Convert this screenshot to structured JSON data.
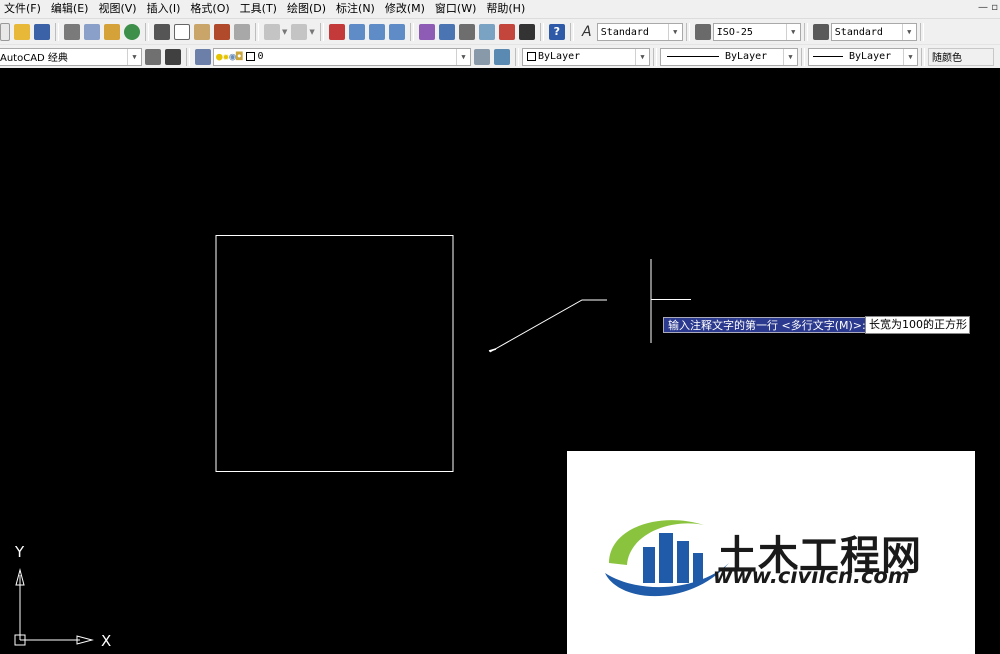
{
  "menu": [
    "文件(F)",
    "编辑(E)",
    "视图(V)",
    "插入(I)",
    "格式(O)",
    "工具(T)",
    "绘图(D)",
    "标注(N)",
    "修改(M)",
    "窗口(W)",
    "帮助(H)"
  ],
  "styles": {
    "text_style": "Standard",
    "dim_style": "ISO-25",
    "table_style": "Standard"
  },
  "workspace": "AutoCAD 经典",
  "layer": {
    "name": "0"
  },
  "properties": {
    "color": "ByLayer",
    "linetype": "ByLayer",
    "lineweight": "ByLayer",
    "plotstyle": "随颜色"
  },
  "command": {
    "prompt": "输入注释文字的第一行 <多行文字(M)>:",
    "input_value": "长宽为100的正方形"
  },
  "ucs": {
    "x_label": "X",
    "y_label": "Y"
  },
  "watermark": {
    "title": "土木工程网",
    "url": "www.civilcn.com",
    "colors": {
      "blue": "#1f5ba8",
      "green": "#8ac43f"
    }
  }
}
